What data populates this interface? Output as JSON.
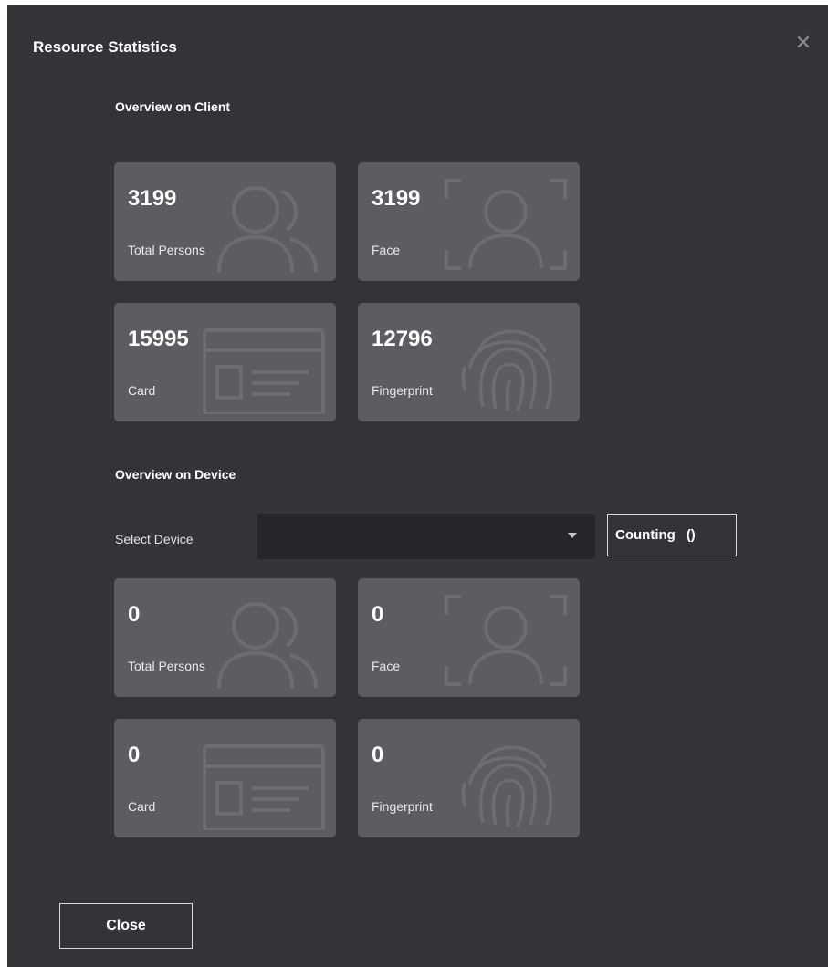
{
  "dialog": {
    "title": "Resource Statistics",
    "close_icon": "close-icon"
  },
  "client": {
    "section_title": "Overview on Client",
    "cards": [
      {
        "value": "3199",
        "label": "Total Persons",
        "icon": "persons-icon"
      },
      {
        "value": "3199",
        "label": "Face",
        "icon": "face-scan-icon"
      },
      {
        "value": "15995",
        "label": "Card",
        "icon": "id-card-icon"
      },
      {
        "value": "12796",
        "label": "Fingerprint",
        "icon": "fingerprint-icon"
      }
    ]
  },
  "device": {
    "section_title": "Overview on Device",
    "select_label": "Select Device",
    "select_value": "",
    "counting_label": "Counting",
    "counting_value": "()",
    "cards": [
      {
        "value": "0",
        "label": "Total Persons",
        "icon": "persons-icon"
      },
      {
        "value": "0",
        "label": "Face",
        "icon": "face-scan-icon"
      },
      {
        "value": "0",
        "label": "Card",
        "icon": "id-card-icon"
      },
      {
        "value": "0",
        "label": "Fingerprint",
        "icon": "fingerprint-icon"
      }
    ]
  },
  "footer": {
    "close_label": "Close"
  },
  "colors": {
    "dialog_bg": "#333438",
    "card_bg": "#5b5d62",
    "select_bg": "#26272b",
    "text": "#ffffff"
  }
}
